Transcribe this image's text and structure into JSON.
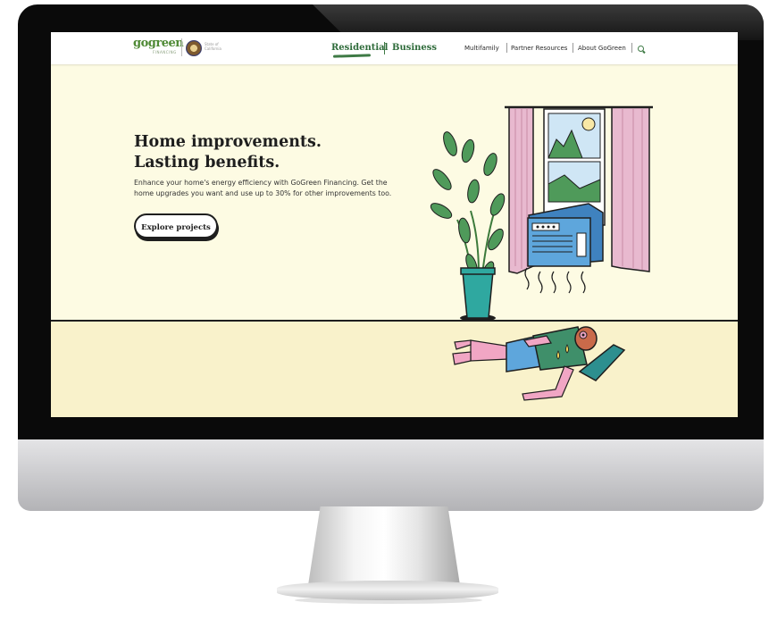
{
  "nav": {
    "logo_main": "gogreen",
    "logo_sub": "FINANCING",
    "state_label": "State of California",
    "primary": [
      "Residential",
      "Business"
    ],
    "secondary": [
      "Multifamily",
      "Partner Resources",
      "About GoGreen"
    ],
    "search_icon": "search-icon"
  },
  "hero": {
    "title_line1": "Home improvements.",
    "title_line2": "Lasting benefits.",
    "description": "Enhance your home's energy efficiency with GoGreen Financing. Get the home upgrades you want and use up to 30% for other improvements too.",
    "cta_label": "Explore projects"
  },
  "colors": {
    "brand_green": "#3e7a45",
    "hero_bg": "#fdfbe3",
    "floor_bg": "#f9f2cb",
    "curtain": "#e8b9cf",
    "ac_unit": "#5ea6dc"
  }
}
